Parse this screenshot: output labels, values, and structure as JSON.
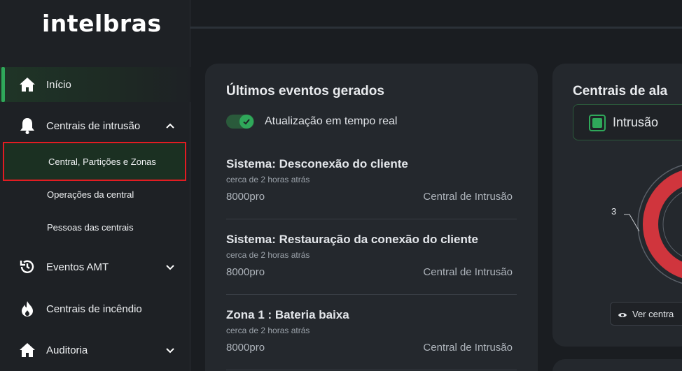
{
  "brand": {
    "logo_text": "intelbras"
  },
  "sidebar": {
    "items": [
      {
        "label": "Início",
        "icon": "home-icon",
        "active": true
      },
      {
        "label": "Centrais de intrusão",
        "icon": "bell-icon",
        "expanded": true
      },
      {
        "label": "Eventos AMT",
        "icon": "history-icon",
        "expanded": false
      },
      {
        "label": "Centrais de incêndio",
        "icon": "flame-icon"
      },
      {
        "label": "Auditoria",
        "icon": "home-icon",
        "expanded": false
      }
    ],
    "subitems": [
      {
        "label": "Central, Partições e Zonas",
        "selected": true
      },
      {
        "label": "Operações da central"
      },
      {
        "label": "Pessoas das centrais"
      }
    ]
  },
  "events_card": {
    "title": "Últimos eventos gerados",
    "toggle_label": "Atualização em tempo real",
    "toggle_on": true,
    "events": [
      {
        "title": "Sistema: Desconexão do cliente",
        "time": "cerca de 2 horas atrás",
        "device": "8000pro",
        "type": "Central de Intrusão"
      },
      {
        "title": "Sistema: Restauração da conexão do cliente",
        "time": "cerca de 2 horas atrás",
        "device": "8000pro",
        "type": "Central de Intrusão"
      },
      {
        "title": "Zona 1 : Bateria baixa",
        "time": "cerca de 2 horas atrás",
        "device": "8000pro",
        "type": "Central de Intrusão"
      }
    ]
  },
  "alarm_card": {
    "title": "Centrais de ala",
    "filter_label": "Intrusão",
    "chart_label": "3",
    "button_label": "Ver centra"
  },
  "colors": {
    "accent": "#2fa85a",
    "highlight_border": "#e21c22",
    "donut": "#d0353d"
  }
}
